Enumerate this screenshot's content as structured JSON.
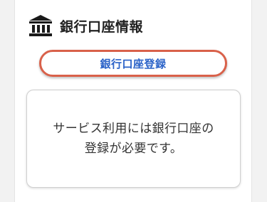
{
  "section": {
    "icon": "bank-icon",
    "title": "銀行口座情報"
  },
  "register_button": {
    "label": "銀行口座登録",
    "border_color": "#d9614a",
    "label_color": "#2a62c8"
  },
  "notice": {
    "line1": "サービス利用には銀行口座の",
    "line2": "登録が必要です。"
  }
}
